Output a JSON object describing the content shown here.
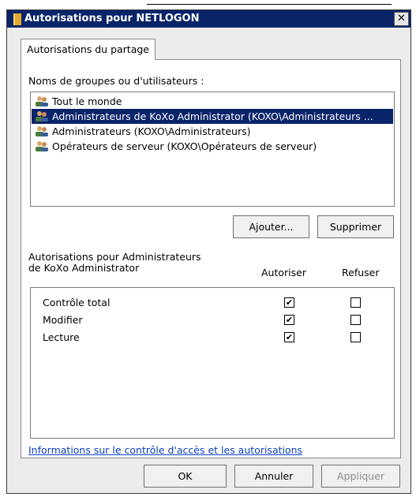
{
  "window": {
    "title": "Autorisations pour NETLOGON",
    "close_glyph": "✕"
  },
  "tab": {
    "label": "Autorisations du partage"
  },
  "groups": {
    "label": "Noms de groupes ou d'utilisateurs :",
    "items": [
      {
        "label": "Tout le monde",
        "selected": false
      },
      {
        "label": "Administrateurs de KoXo Administrator (KOXO\\Administrateurs ...",
        "selected": true
      },
      {
        "label": "Administrateurs (KOXO\\Administrateurs)",
        "selected": false
      },
      {
        "label": "Opérateurs de serveur (KOXO\\Opérateurs de serveur)",
        "selected": false
      }
    ],
    "add_button": "Ajouter...",
    "remove_button": "Supprimer"
  },
  "permissions": {
    "title_line1": "Autorisations pour Administrateurs",
    "title_line2": "de KoXo Administrator",
    "allow_header": "Autoriser",
    "deny_header": "Refuser",
    "rows": [
      {
        "label": "Contrôle total",
        "allow": true,
        "deny": false
      },
      {
        "label": "Modifier",
        "allow": true,
        "deny": false
      },
      {
        "label": "Lecture",
        "allow": true,
        "deny": false
      }
    ]
  },
  "help_link": "Informations sur le contrôle d'accès et les autorisations",
  "footer": {
    "ok": "OK",
    "cancel": "Annuler",
    "apply": "Appliquer"
  },
  "icons": {
    "window": "folder-shield-icon",
    "group": "users-group-icon"
  },
  "colors": {
    "selection": "#0a246a",
    "link": "#0b3fbf",
    "dialog_bg": "#ececec"
  }
}
